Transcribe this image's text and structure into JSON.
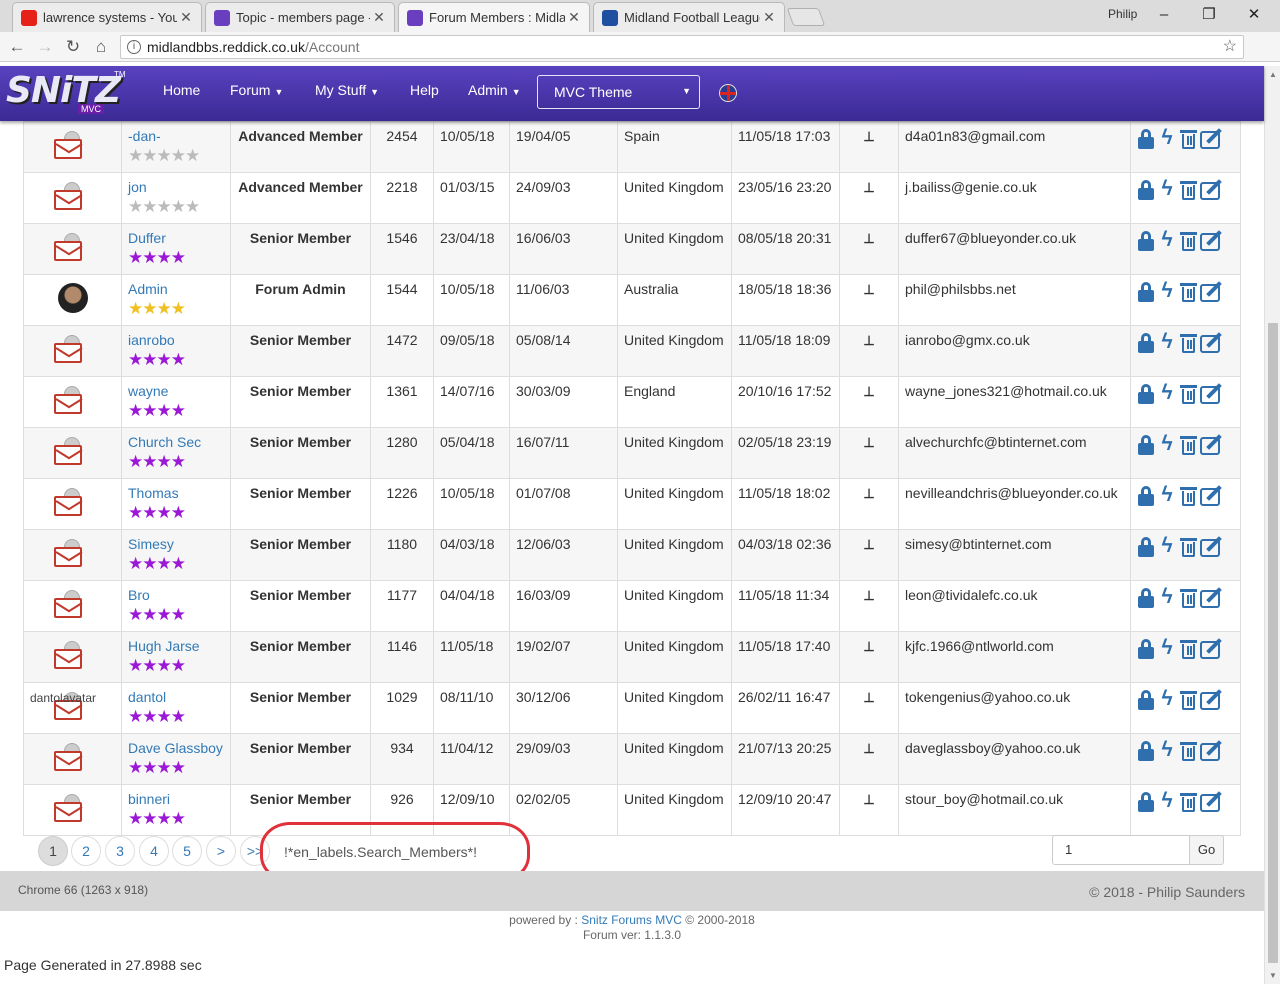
{
  "browser": {
    "tabs": [
      {
        "title": "lawrence systems - YouTu",
        "favicon_color": "#e62117"
      },
      {
        "title": "Topic - members page - r",
        "favicon_color": "#6a3fbf"
      },
      {
        "title": "Forum Members : Midlan",
        "favicon_color": "#6a3fbf"
      },
      {
        "title": "Midland Football League",
        "favicon_color": "#1f4fa0"
      }
    ],
    "profile": "Philip",
    "url_host": "midlandbbs.reddick.co.uk",
    "url_path": "/Account",
    "icons": {
      "back": "back-arrow-icon",
      "forward": "forward-arrow-icon",
      "reload": "reload-icon",
      "home": "home-icon",
      "bookmark": "star-icon",
      "menu": "kebab-menu-icon"
    }
  },
  "site": {
    "logo_text": "SNiTZ",
    "logo_sub": "MVC",
    "logo_tm": "TM",
    "nav": [
      {
        "label": "Home",
        "dropdown": false
      },
      {
        "label": "Forum",
        "dropdown": true
      },
      {
        "label": "My Stuff",
        "dropdown": true
      },
      {
        "label": "Help",
        "dropdown": false
      },
      {
        "label": "Admin",
        "dropdown": true
      }
    ],
    "theme_select": "MVC Theme",
    "language_flag": "uk-flag-icon"
  },
  "members": [
    {
      "name": "-dan-",
      "avatar": "mail",
      "stars": "gray",
      "rank": "Advanced Member",
      "posts": "2454",
      "last_post": "10/05/18",
      "joined": "19/04/05",
      "location": "Spain",
      "last_visit": "11/05/18 17:03",
      "email": "d4a01n83@gmail.com"
    },
    {
      "name": "jon",
      "avatar": "mail",
      "stars": "gray",
      "rank": "Advanced Member",
      "posts": "2218",
      "last_post": "01/03/15",
      "joined": "24/09/03",
      "location": "United Kingdom",
      "last_visit": "23/05/16 23:20",
      "email": "j.bailiss@genie.co.uk"
    },
    {
      "name": "Duffer",
      "avatar": "mail",
      "stars": "purple",
      "rank": "Senior Member",
      "posts": "1546",
      "last_post": "23/04/18",
      "joined": "16/06/03",
      "location": "United Kingdom",
      "last_visit": "08/05/18 20:31",
      "email": "duffer67@blueyonder.co.uk"
    },
    {
      "name": "Admin",
      "avatar": "photo",
      "stars": "gold",
      "rank": "Forum Admin",
      "posts": "1544",
      "last_post": "10/05/18",
      "joined": "11/06/03",
      "location": "Australia",
      "last_visit": "18/05/18 18:36",
      "email": "phil@philsbbs.net"
    },
    {
      "name": "ianrobo",
      "avatar": "mail",
      "stars": "purple",
      "rank": "Senior Member",
      "posts": "1472",
      "last_post": "09/05/18",
      "joined": "05/08/14",
      "location": "United Kingdom",
      "last_visit": "11/05/18 18:09",
      "email": "ianrobo@gmx.co.uk"
    },
    {
      "name": "wayne",
      "avatar": "mail",
      "stars": "purple",
      "rank": "Senior Member",
      "posts": "1361",
      "last_post": "14/07/16",
      "joined": "30/03/09",
      "location": "England",
      "last_visit": "20/10/16 17:52",
      "email": "wayne_jones321@hotmail.co.uk"
    },
    {
      "name": "Church Sec",
      "avatar": "mail",
      "stars": "purple",
      "rank": "Senior Member",
      "posts": "1280",
      "last_post": "05/04/18",
      "joined": "16/07/11",
      "location": "United Kingdom",
      "last_visit": "02/05/18 23:19",
      "email": "alvechurchfc@btinternet.com"
    },
    {
      "name": "Thomas",
      "avatar": "mail",
      "stars": "purple",
      "rank": "Senior Member",
      "posts": "1226",
      "last_post": "10/05/18",
      "joined": "01/07/08",
      "location": "United Kingdom",
      "last_visit": "11/05/18 18:02",
      "email": "nevilleandchris@blueyonder.co.uk"
    },
    {
      "name": "Simesy",
      "avatar": "mail",
      "stars": "purple",
      "rank": "Senior Member",
      "posts": "1180",
      "last_post": "04/03/18",
      "joined": "12/06/03",
      "location": "United Kingdom",
      "last_visit": "04/03/18 02:36",
      "email": "simesy@btinternet.com"
    },
    {
      "name": "Bro",
      "avatar": "mail",
      "stars": "purple",
      "rank": "Senior Member",
      "posts": "1177",
      "last_post": "04/04/18",
      "joined": "16/03/09",
      "location": "United Kingdom",
      "last_visit": "11/05/18 11:34",
      "email": "leon@tividalefc.co.uk"
    },
    {
      "name": "Hugh Jarse",
      "avatar": "mail",
      "stars": "purple",
      "rank": "Senior Member",
      "posts": "1146",
      "last_post": "11/05/18",
      "joined": "19/02/07",
      "location": "United Kingdom",
      "last_visit": "11/05/18 17:40",
      "email": "kjfc.1966@ntlworld.com"
    },
    {
      "name": "dantol",
      "avatar": "broken",
      "avatar_alt": "dantolavatar",
      "stars": "purple",
      "rank": "Senior Member",
      "posts": "1029",
      "last_post": "08/11/10",
      "joined": "30/12/06",
      "location": "United Kingdom",
      "last_visit": "26/02/11 16:47",
      "email": "tokengenius@yahoo.co.uk"
    },
    {
      "name": "Dave Glassboy",
      "avatar": "mail",
      "stars": "purple",
      "rank": "Senior Member",
      "posts": "934",
      "last_post": "11/04/12",
      "joined": "29/09/03",
      "location": "United Kingdom",
      "last_visit": "21/07/13 20:25",
      "email": "daveglassboy@yahoo.co.uk"
    },
    {
      "name": "binneri",
      "avatar": "mail",
      "stars": "purple",
      "rank": "Senior Member",
      "posts": "926",
      "last_post": "12/09/10",
      "joined": "02/02/05",
      "location": "United Kingdom",
      "last_visit": "12/09/10 20:47",
      "email": "stour_boy@hotmail.co.uk"
    }
  ],
  "row_actions": [
    "lock-icon",
    "bolt-icon",
    "trash-icon",
    "edit-icon"
  ],
  "pagination": {
    "pages": [
      "1",
      "2",
      "3",
      "4",
      "5"
    ],
    "active": "1",
    "next": ">",
    "last": ">>",
    "search_label": "!*en_labels.Search_Members*!",
    "goto_value": "1",
    "go_label": "Go"
  },
  "footer": {
    "left": "Chrome 66 (1263 x 918)",
    "right": "© 2018 - Philip Saunders",
    "powered_prefix": "powered by : ",
    "powered_link": "Snitz Forums MVC",
    "powered_suffix": " © 2000-2018",
    "version": "Forum ver: 1.1.3.0",
    "generated": "Page Generated in 27.8988 sec"
  }
}
